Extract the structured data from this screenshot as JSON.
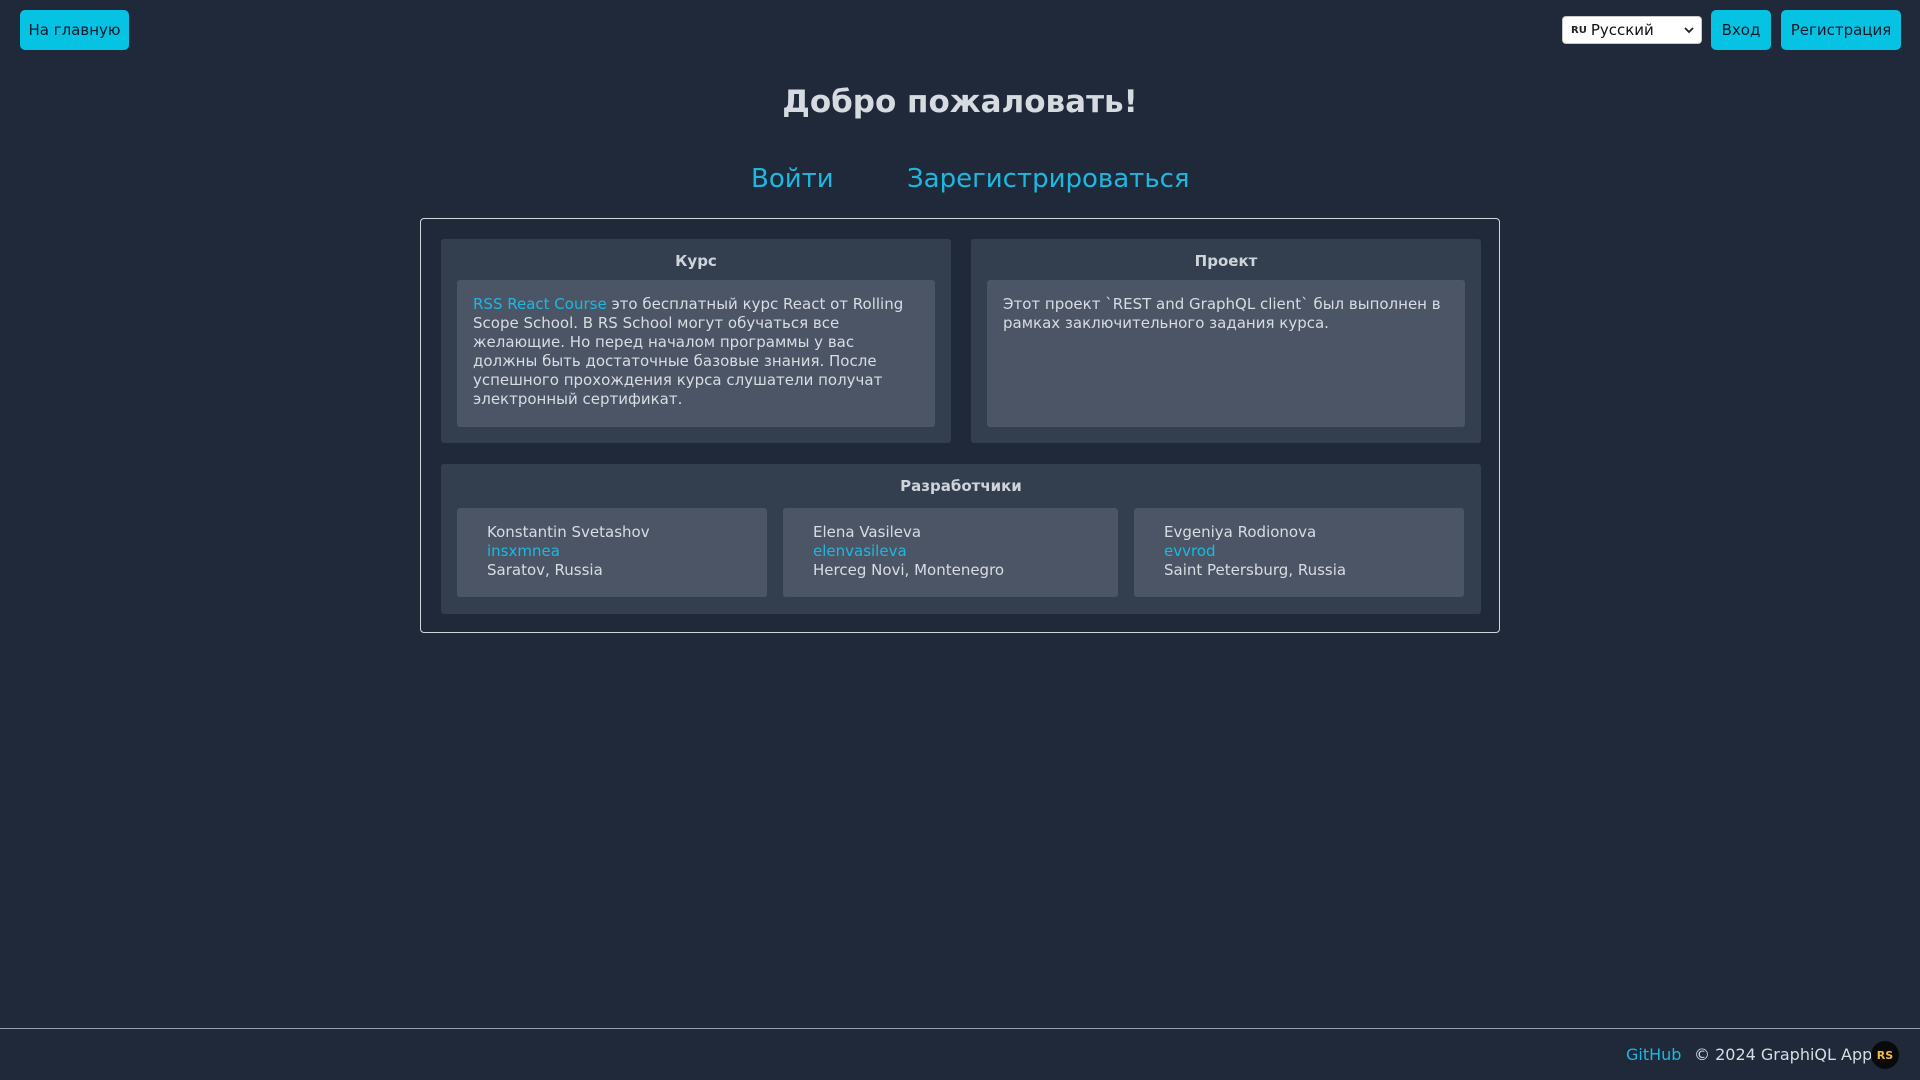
{
  "header": {
    "home_label": "На главную",
    "language": {
      "flag": "RU",
      "selected": "Русский"
    },
    "login_label": "Вход",
    "register_label": "Регистрация"
  },
  "main": {
    "title": "Добро пожаловать!",
    "login_link": "Войти",
    "register_link": "Зарегистрироваться",
    "course": {
      "title": "Курс",
      "link_text": "RSS React Course",
      "text": " это бесплатный курс React от Rolling Scope School. В RS School могут обучаться все желающие. Но перед началом программы у вас должны быть достаточные базовые знания. После успешного прохождения курса слушатели получат электронный сертификат."
    },
    "project": {
      "title": "Проект",
      "text": "Этот проект `REST and GraphQL client` был выполнен в рамках заключительного задания курса."
    },
    "developers": {
      "title": "Разработчики",
      "items": [
        {
          "name": "Konstantin Svetashov",
          "github": "insxmnea",
          "location": "Saratov, Russia"
        },
        {
          "name": "Elena Vasileva",
          "github": "elenvasileva",
          "location": "Herceg Novi, Montenegro"
        },
        {
          "name": "Evgeniya Rodionova",
          "github": "evvrod",
          "location": "Saint Petersburg, Russia"
        }
      ]
    }
  },
  "footer": {
    "github_label": "GitHub",
    "copyright": "© 2024 GraphiQL App",
    "logo_text": "RS"
  },
  "colors": {
    "background": "#1f293a",
    "accent": "#06c3e4",
    "link": "#1db8e0",
    "panel": "#333e4f",
    "panel_inner": "#4c5566"
  },
  "icons": {
    "language_dropdown": "chevron-down-icon",
    "footer_logo": "rs-school-logo"
  }
}
